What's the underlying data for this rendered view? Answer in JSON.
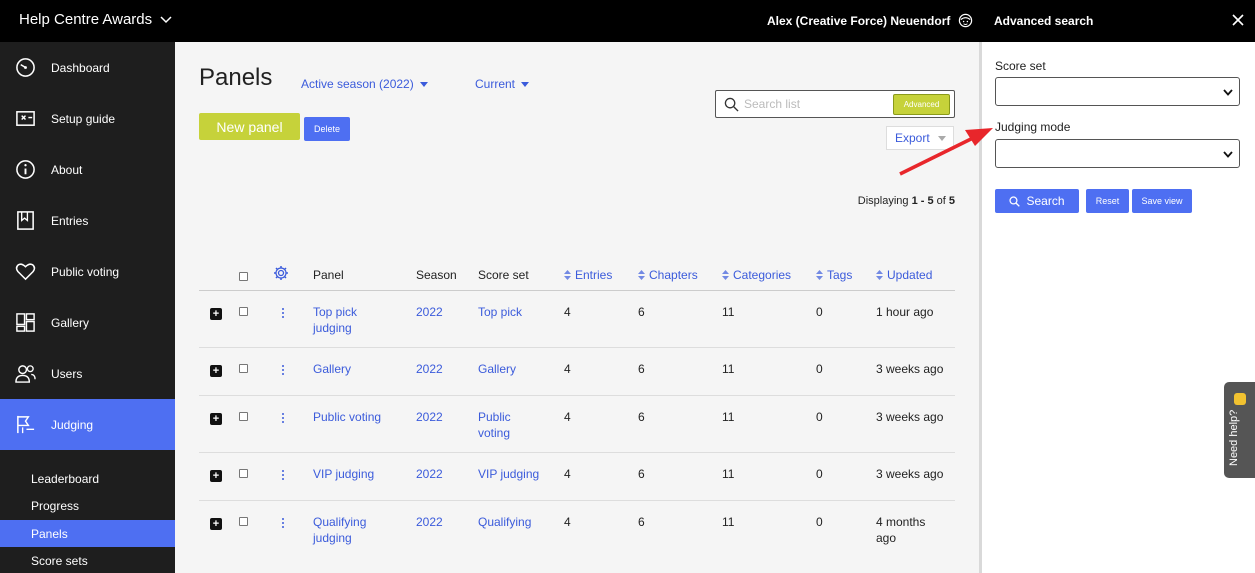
{
  "app": {
    "title": "Help Centre Awards",
    "user": "Alex (Creative Force) Neuendorf"
  },
  "sidebar": {
    "items": [
      {
        "label": "Dashboard",
        "icon": "dashboard-icon"
      },
      {
        "label": "Setup guide",
        "icon": "setup-guide-icon"
      },
      {
        "label": "About",
        "icon": "info-icon"
      },
      {
        "label": "Entries",
        "icon": "bookmark-icon"
      },
      {
        "label": "Public voting",
        "icon": "heart-icon"
      },
      {
        "label": "Gallery",
        "icon": "gallery-icon"
      },
      {
        "label": "Users",
        "icon": "users-icon"
      },
      {
        "label": "Judging",
        "icon": "flag-icon",
        "active": true
      }
    ],
    "subitems": [
      {
        "label": "Leaderboard"
      },
      {
        "label": "Progress"
      },
      {
        "label": "Panels",
        "active": true
      },
      {
        "label": "Score sets"
      }
    ]
  },
  "main": {
    "title": "Panels",
    "season_filter": "Active season (2022)",
    "status_filter": "Current",
    "new_button": "New panel",
    "delete_button": "Delete",
    "search_placeholder": "Search list",
    "advanced_button": "Advanced",
    "export_button": "Export",
    "displaying": {
      "prefix": "Displaying ",
      "range": "1 - 5",
      "middle": " of ",
      "total": "5"
    }
  },
  "table": {
    "columns": [
      "Panel",
      "Season",
      "Score set",
      "Entries",
      "Chapters",
      "Categories",
      "Tags",
      "Updated"
    ],
    "rows": [
      {
        "panel": "Top pick judging",
        "season": "2022",
        "score_set": "Top pick",
        "entries": "4",
        "chapters": "6",
        "categories": "11",
        "tags": "0",
        "updated": "1 hour ago"
      },
      {
        "panel": "Gallery",
        "season": "2022",
        "score_set": "Gallery",
        "entries": "4",
        "chapters": "6",
        "categories": "11",
        "tags": "0",
        "updated": "3 weeks ago"
      },
      {
        "panel": "Public voting",
        "season": "2022",
        "score_set": "Public voting",
        "entries": "4",
        "chapters": "6",
        "categories": "11",
        "tags": "0",
        "updated": "3 weeks ago"
      },
      {
        "panel": "VIP judging",
        "season": "2022",
        "score_set": "VIP judging",
        "entries": "4",
        "chapters": "6",
        "categories": "11",
        "tags": "0",
        "updated": "3 weeks ago"
      },
      {
        "panel": "Qualifying judging",
        "season": "2022",
        "score_set": "Qualifying",
        "entries": "4",
        "chapters": "6",
        "categories": "11",
        "tags": "0",
        "updated": "4 months ago"
      }
    ]
  },
  "advanced_search": {
    "title": "Advanced search",
    "score_set_label": "Score set",
    "judging_mode_label": "Judging mode",
    "search_button": "Search",
    "reset_button": "Reset",
    "save_view_button": "Save view"
  },
  "help": {
    "label": "Need help?"
  },
  "colors": {
    "accent": "#4e6ff2",
    "lime": "#c6d23a",
    "link": "#3b5bdb",
    "sidebar_bg": "#1e1e1e",
    "annotation_arrow": "#e8262b"
  }
}
